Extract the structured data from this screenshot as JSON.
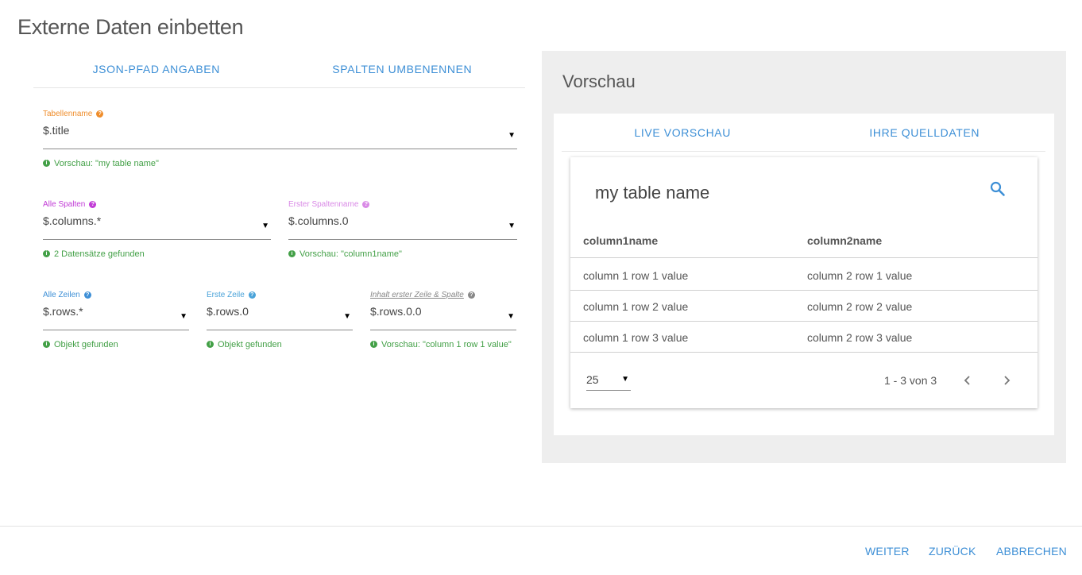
{
  "dialog": {
    "title": "Externe Daten einbetten"
  },
  "left_tabs": [
    {
      "label": "JSON-PFAD ANGABEN"
    },
    {
      "label": "SPALTEN UMBENENNEN"
    }
  ],
  "fields": {
    "table_name": {
      "label": "Tabellenname",
      "value": "$.title",
      "hint": "Vorschau: \"my table name\""
    },
    "all_columns": {
      "label": "Alle Spalten",
      "value": "$.columns.*",
      "hint": "2 Datensätze gefunden"
    },
    "first_column_name": {
      "label": "Erster Spaltenname",
      "value": "$.columns.0",
      "hint": "Vorschau: \"column1name\""
    },
    "all_rows": {
      "label": "Alle Zeilen",
      "value": "$.rows.*",
      "hint": "Objekt gefunden"
    },
    "first_row": {
      "label": "Erste Zeile",
      "value": "$.rows.0",
      "hint": "Objekt gefunden"
    },
    "first_cell": {
      "label": "Inhalt erster Zeile & Spalte",
      "value": "$.rows.0.0",
      "hint": "Vorschau: \"column 1 row 1 value\""
    }
  },
  "preview": {
    "title": "Vorschau",
    "tabs": [
      {
        "label": "LIVE VORSCHAU"
      },
      {
        "label": "IHRE QUELLDATEN"
      }
    ],
    "table": {
      "name": "my table name",
      "columns": [
        "column1name",
        "column2name"
      ],
      "rows": [
        [
          "column 1 row 1 value",
          "column 2 row 1 value"
        ],
        [
          "column 1 row 2 value",
          "column 2 row 2 value"
        ],
        [
          "column 1 row 3 value",
          "column 2 row 3 value"
        ]
      ],
      "per_page": "25",
      "page_info": "1 - 3 von 3"
    }
  },
  "actions": {
    "next": "WEITER",
    "back": "ZURÜCK",
    "cancel": "ABBRECHEN"
  },
  "icons": {
    "help": "question-circle-icon",
    "info": "info-circle-icon",
    "search": "search-icon",
    "prev": "chevron-left-icon",
    "next": "chevron-right-icon",
    "dropdown": "caret-down-icon"
  },
  "colors": {
    "accent": "#3d8fd6",
    "success": "#43a047",
    "orange": "#ef8d2b",
    "magenta": "#c13cd6",
    "pink": "#d98ae6",
    "panel_bg": "#eeeeee"
  }
}
